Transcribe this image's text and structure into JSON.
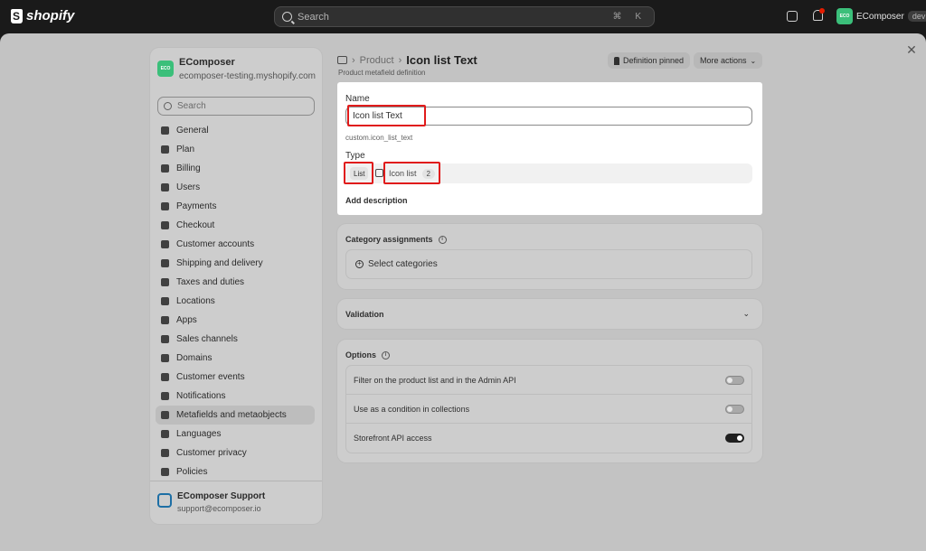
{
  "topbar": {
    "brand": "shopify",
    "search_placeholder": "Search",
    "search_shortcut": "⌘ K",
    "store_badge": "ECO",
    "store_name": "EComposer",
    "env_tag": "dev"
  },
  "sidebar": {
    "store_badge": "ECO",
    "store_name": "EComposer",
    "store_url": "ecomposer-testing.myshopify.com",
    "search_placeholder": "Search",
    "items": [
      {
        "label": "General",
        "icon": "store-icon"
      },
      {
        "label": "Plan",
        "icon": "plan-icon"
      },
      {
        "label": "Billing",
        "icon": "billing-icon"
      },
      {
        "label": "Users",
        "icon": "users-icon"
      },
      {
        "label": "Payments",
        "icon": "payments-icon"
      },
      {
        "label": "Checkout",
        "icon": "cart-icon"
      },
      {
        "label": "Customer accounts",
        "icon": "person-icon"
      },
      {
        "label": "Shipping and delivery",
        "icon": "truck-icon"
      },
      {
        "label": "Taxes and duties",
        "icon": "tax-icon"
      },
      {
        "label": "Locations",
        "icon": "location-icon"
      },
      {
        "label": "Apps",
        "icon": "apps-icon"
      },
      {
        "label": "Sales channels",
        "icon": "channels-icon"
      },
      {
        "label": "Domains",
        "icon": "globe-icon"
      },
      {
        "label": "Customer events",
        "icon": "events-icon"
      },
      {
        "label": "Notifications",
        "icon": "bell-icon"
      },
      {
        "label": "Metafields and metaobjects",
        "icon": "metafields-icon",
        "active": true
      },
      {
        "label": "Languages",
        "icon": "language-icon"
      },
      {
        "label": "Customer privacy",
        "icon": "lock-icon"
      },
      {
        "label": "Policies",
        "icon": "policy-icon"
      }
    ],
    "support_name": "EComposer Support",
    "support_email": "support@ecomposer.io"
  },
  "header": {
    "breadcrumb_parent": "Product",
    "title": "Icon list Text",
    "subtitle": "Product metafield definition",
    "pinned_label": "Definition pinned",
    "more_actions_label": "More actions"
  },
  "definition": {
    "name_label": "Name",
    "name_value": "Icon list Text",
    "namespace_key": "custom.icon_list_text",
    "type_label": "Type",
    "type_list": "List",
    "type_name": "Icon list",
    "type_count": "2",
    "add_description": "Add description"
  },
  "category": {
    "title": "Category assignments",
    "select_label": "Select categories"
  },
  "validation": {
    "title": "Validation"
  },
  "options": {
    "title": "Options",
    "rows": [
      {
        "label": "Filter on the product list and in the Admin API",
        "on": false
      },
      {
        "label": "Use as a condition in collections",
        "on": false
      },
      {
        "label": "Storefront API access",
        "on": true
      }
    ]
  },
  "colors": {
    "accent_green": "#3bbf7a",
    "highlight_red": "#e01b1b"
  }
}
